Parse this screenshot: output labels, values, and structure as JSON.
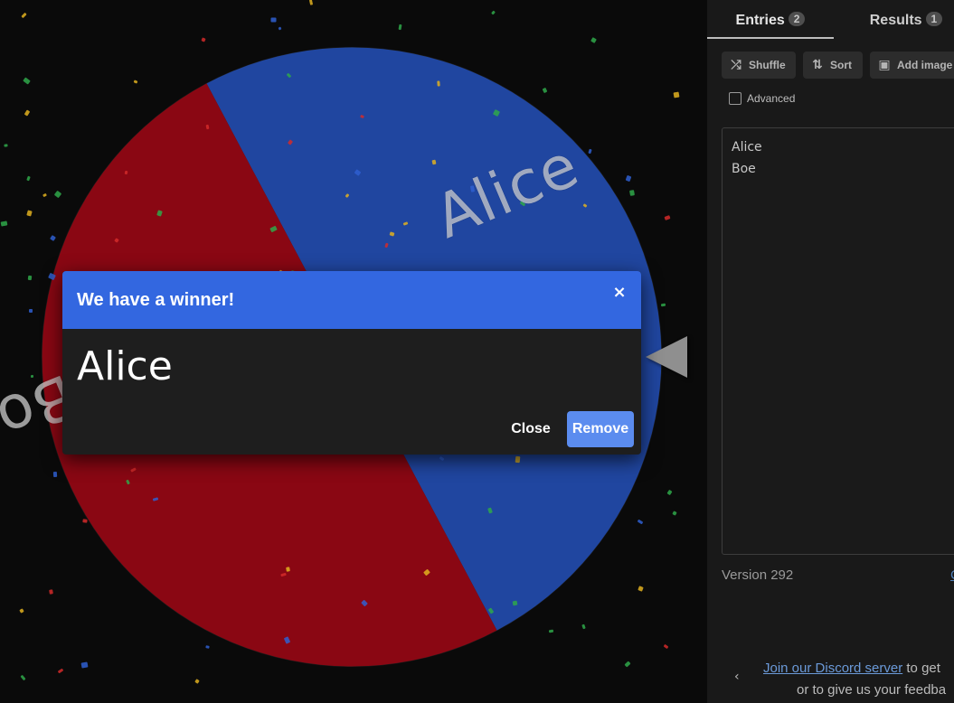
{
  "wheel": {
    "segments": [
      {
        "label": "Alice",
        "color": "#2046a0"
      },
      {
        "label": "Boe",
        "color": "#8a0713"
      }
    ],
    "pointer_color": "#8f8f8f"
  },
  "dialog": {
    "title": "We have a winner!",
    "close_icon": "×",
    "winner": "Alice",
    "close_label": "Close",
    "remove_label": "Remove",
    "header_color": "#3367e0",
    "remove_color": "#5b8cef"
  },
  "panel": {
    "tabs": [
      {
        "label": "Entries",
        "count": "2",
        "active": true
      },
      {
        "label": "Results",
        "count": "1",
        "active": false
      }
    ],
    "toolbar": {
      "shuffle_label": "Shuffle",
      "shuffle_icon": "shuffle-icon",
      "sort_label": "Sort",
      "sort_icon": "sort-icon",
      "add_image_label": "Add image",
      "add_image_icon": "image-icon"
    },
    "advanced_label": "Advanced",
    "entries": [
      "Alice",
      "Boe"
    ],
    "version": "Version 292",
    "version_link": "C",
    "footer": {
      "chevron_icon": "chevron-left-icon",
      "discord_link": "Join our Discord server",
      "discord_after": " to get",
      "line2": "or to give us your feedba"
    }
  },
  "confetti_colors": [
    "#e0b020",
    "#2fa84a",
    "#d22a2a",
    "#2f5fd0"
  ]
}
